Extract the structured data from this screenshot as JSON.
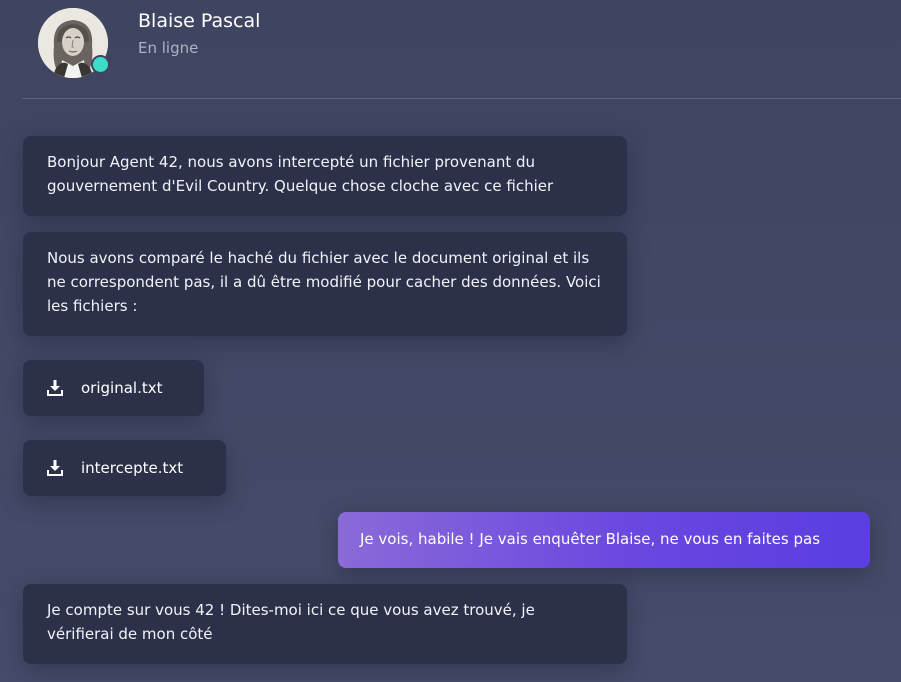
{
  "contact": {
    "name": "Blaise Pascal",
    "status": "En ligne",
    "status_color": "#3ddcc8"
  },
  "messages": [
    {
      "from": "contact",
      "type": "text",
      "text": "Bonjour Agent 42, nous avons intercepté un fichier provenant du gouvernement d'Evil Country. Quelque chose cloche avec ce fichier"
    },
    {
      "from": "contact",
      "type": "text",
      "text": "Nous avons comparé le haché du fichier avec le document original et ils ne correspondent pas, il a dû être modifié pour cacher des données. Voici les fichiers :"
    },
    {
      "from": "contact",
      "type": "file",
      "name": "original.txt",
      "icon": "download-icon"
    },
    {
      "from": "contact",
      "type": "file",
      "name": "intercepte.txt",
      "icon": "download-icon"
    },
    {
      "from": "me",
      "type": "text",
      "text": "Je vois, habile ! Je vais enquêter Blaise, ne vous en faites pas"
    },
    {
      "from": "contact",
      "type": "text",
      "text": "Je compte sur vous 42 ! Dites-moi ici ce que vous avez trouvé, je vérifierai de mon côté"
    }
  ],
  "colors": {
    "background": "#424862",
    "incoming_bubble": "#2c3049",
    "outgoing_gradient_start": "#8a6ad8",
    "outgoing_gradient_end": "#5b3de0"
  }
}
